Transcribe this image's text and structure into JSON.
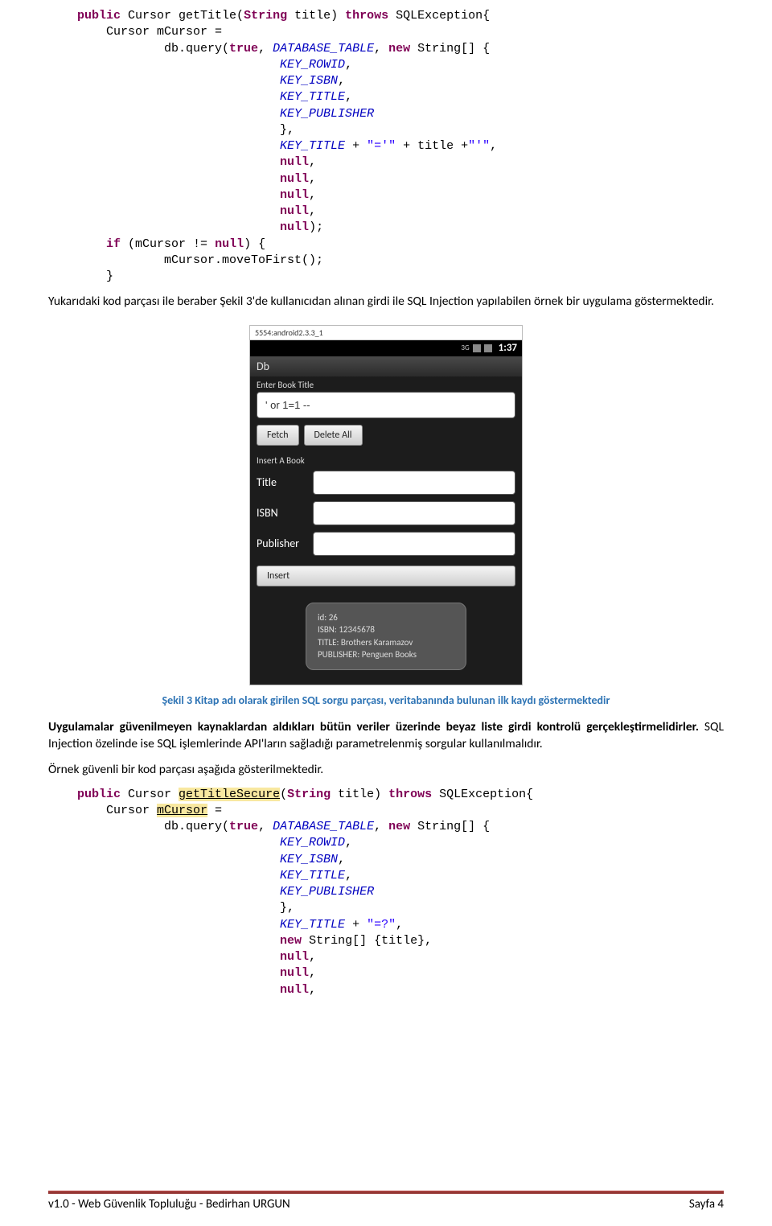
{
  "code1": {
    "sig_kw_public": "public",
    "sig_type": " Cursor getTitle(",
    "sig_kw_string": "String",
    "sig_rest": " title) ",
    "sig_kw_throws": "throws",
    "sig_exc": " SQLException{",
    "l2": "        Cursor mCursor =",
    "l3a": "                db.query(",
    "l3_kw_true": "true",
    "l3b": ", ",
    "l3_field": "DATABASE_TABLE",
    "l3c": ", ",
    "l3_kw_new": "new",
    "l3d": " String[] {",
    "l4": "KEY_ROWID",
    "l5": "KEY_ISBN",
    "l6": "KEY_TITLE",
    "l7": "KEY_PUBLISHER",
    "l8": "},",
    "l9a": "KEY_TITLE",
    "l9b": " + ",
    "l9s1": "\"='\"",
    "l9c": " + title +",
    "l9s2": "\"'\"",
    "l9d": ",",
    "l10": "null",
    "l11": "null",
    "l12": "null",
    "l13": "null",
    "l14a": "null",
    "l14b": ");",
    "l15_kw_if": "if",
    "l15a": " (mCursor != ",
    "l15_kw_null": "null",
    "l15b": ") {",
    "l16": "                mCursor.moveToFirst();",
    "l17": "        }"
  },
  "para1": "Yukarıdaki kod parçası ile beraber Şekil 3'de kullanıcıdan alınan girdi ile SQL Injection yapılabilen örnek bir uygulama göstermektedir.",
  "emulator": {
    "window_title": "5554:android2.3.3_1",
    "status_3g": "3G",
    "status_time": "1:37",
    "app_title": "Db",
    "enter_label": "Enter Book Title",
    "search_value": "' or 1=1 --",
    "fetch_btn": "Fetch",
    "delete_btn": "Delete All",
    "insert_label": "Insert A Book",
    "title_lbl": "Title",
    "isbn_lbl": "ISBN",
    "publisher_lbl": "Publisher",
    "insert_btn": "Insert",
    "toast_l1": "id: 26",
    "toast_l2": "ISBN: 12345678",
    "toast_l3": "TITLE: Brothers Karamazov",
    "toast_l4": "PUBLISHER: Penguen Books"
  },
  "caption": "Şekil 3 Kitap adı olarak girilen SQL sorgu parçası, veritabanında bulunan ilk kaydı göstermektedir",
  "para2_bold": "Uygulamalar güvenilmeyen kaynaklardan aldıkları bütün veriler üzerinde beyaz liste girdi kontrolü gerçekleştirmelidirler.",
  "para2_rest": " SQL Injection özelinde ise SQL işlemlerinde API'ların sağladığı parametrelenmiş sorgular kullanılmalıdır.",
  "para3": "Örnek güvenli bir kod parçası aşağıda gösterilmektedir.",
  "code2": {
    "sig_kw_public": "public",
    "sig_a": " Cursor ",
    "sig_warn": "getTitleSecure",
    "sig_b": "(",
    "sig_kw_string": "String",
    "sig_c": " title) ",
    "sig_kw_throws": "throws",
    "sig_d": " SQLException{",
    "l2a": "        Cursor ",
    "l2_warn": "mCursor",
    "l2b": " =",
    "l3a": "                db.query(",
    "l3_kw_true": "true",
    "l3b": ", ",
    "l3_field": "DATABASE_TABLE",
    "l3c": ", ",
    "l3_kw_new": "new",
    "l3d": " String[] {",
    "l4": "KEY_ROWID",
    "l5": "KEY_ISBN",
    "l6": "KEY_TITLE",
    "l7": "KEY_PUBLISHER",
    "l8": "},",
    "l9a": "KEY_TITLE",
    "l9b": " + ",
    "l9s": "\"=?\"",
    "l9c": ",",
    "l10_kw_new": "new",
    "l10a": " String[] {title},",
    "l11": "null",
    "l12": "null",
    "l13": "null"
  },
  "footer": {
    "left": "v1.0 - Web Güvenlik Topluluğu - Bedirhan URGUN",
    "right": "Sayfa 4"
  }
}
